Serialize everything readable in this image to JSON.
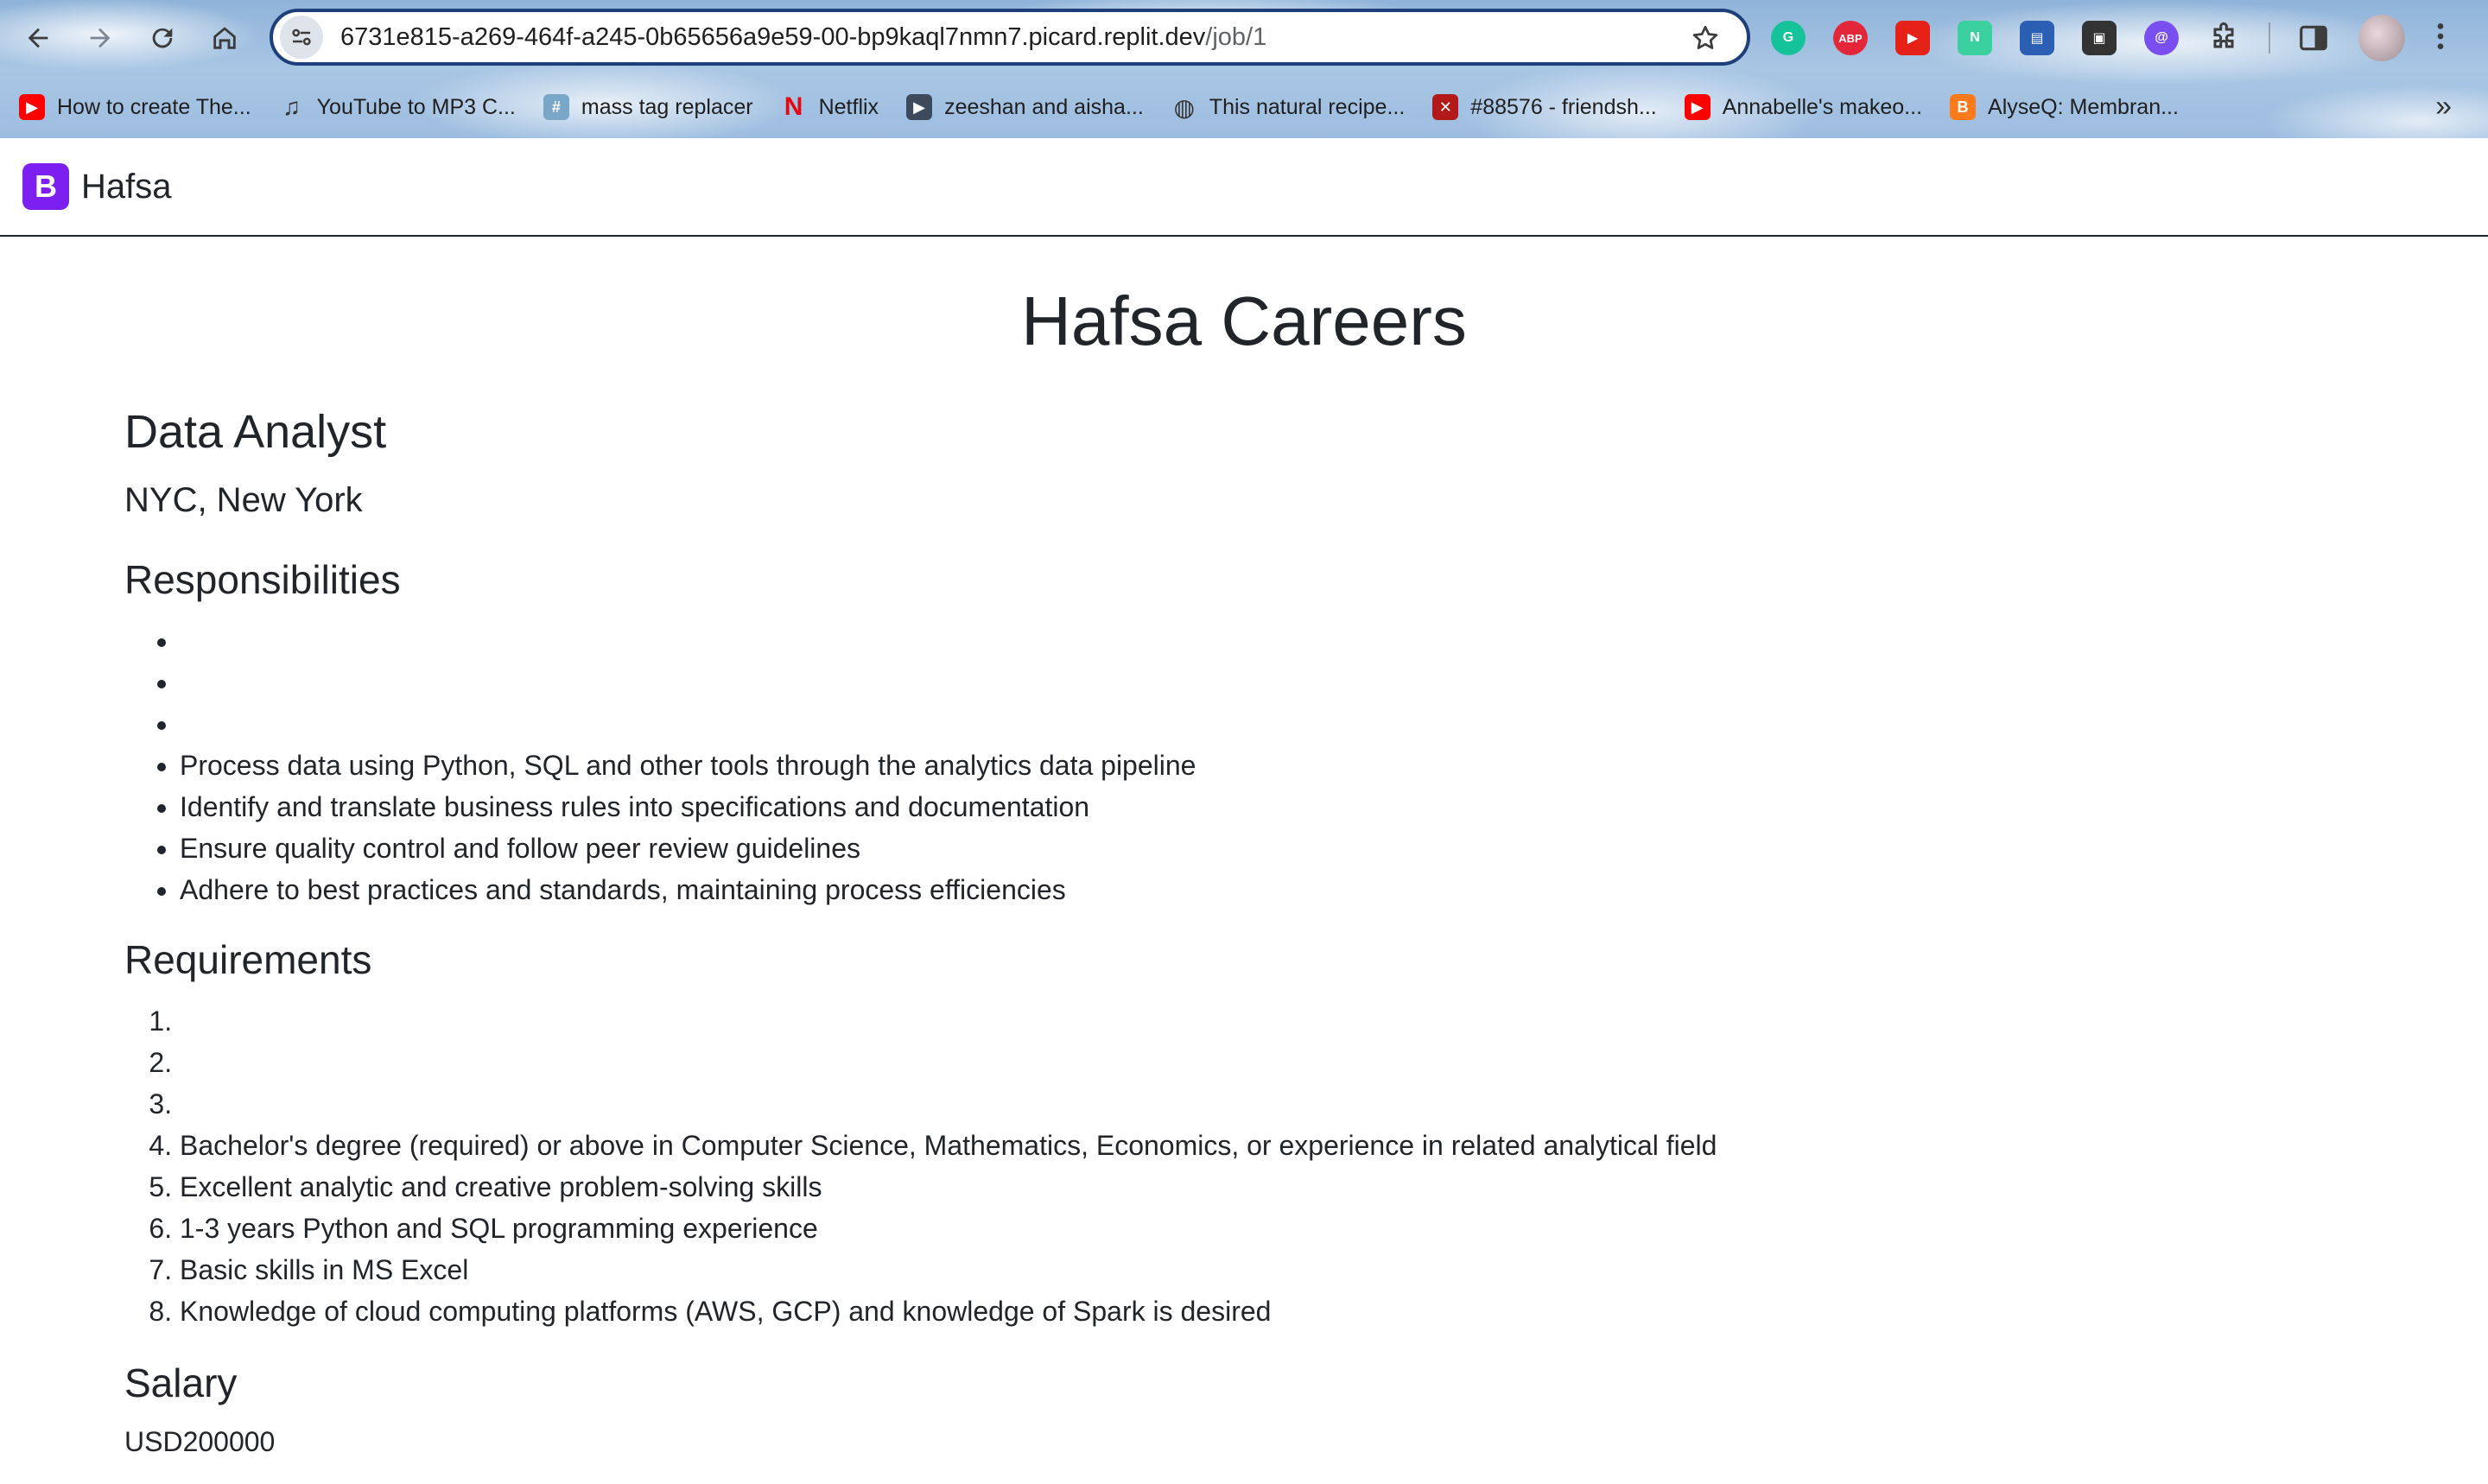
{
  "browser": {
    "url_host": "6731e815-a269-464f-a245-0b65656a9e59-00-bp9kaql7nmn7.picard.replit.dev",
    "url_path": "/job/1",
    "bookmarks": [
      {
        "icon": "youtube-icon",
        "color": "#ff0000",
        "label": "How to create The..."
      },
      {
        "icon": "music-note-icon",
        "color": "#333333",
        "label": "YouTube to MP3 C..."
      },
      {
        "icon": "hashtag-icon",
        "color": "#7aa7c7",
        "label": "mass tag replacer"
      },
      {
        "icon": "netflix-icon",
        "color": "#e50914",
        "label": "Netflix"
      },
      {
        "icon": "play-circle-icon",
        "color": "#3c4a5c",
        "label": "zeeshan and aisha..."
      },
      {
        "icon": "globe-icon",
        "color": "#333333",
        "label": "This natural recipe..."
      },
      {
        "icon": "ao3-icon",
        "color": "#b21a1a",
        "label": "#88576 - friendsh..."
      },
      {
        "icon": "youtube-icon",
        "color": "#ff0000",
        "label": "Annabelle's makeo..."
      },
      {
        "icon": "blogger-icon",
        "color": "#ff7a1a",
        "label": "AlyseQ: Membran..."
      }
    ],
    "extensions": [
      {
        "icon": "grammarly-icon",
        "color": "#15c39a",
        "text": "G"
      },
      {
        "icon": "adblock-icon",
        "color": "#e3263a",
        "text": "ABP"
      },
      {
        "icon": "youtube-ext-icon",
        "color": "#e62117",
        "text": "▶"
      },
      {
        "icon": "notion-n-icon",
        "color": "#3ad0a0",
        "text": "N"
      },
      {
        "icon": "reader-icon",
        "color": "#2b5fb3",
        "text": "▤"
      },
      {
        "icon": "picture-in-picture-icon",
        "color": "#333333",
        "text": "▣"
      },
      {
        "icon": "extension-purple-icon",
        "color": "#7a4ff0",
        "text": "@"
      }
    ]
  },
  "navbar": {
    "logo_letter": "B",
    "brand": "Hafsa"
  },
  "page": {
    "title": "Hafsa Careers",
    "job_title": "Data Analyst",
    "location": "NYC, New York",
    "responsibilities_heading": "Responsibilities",
    "responsibilities": [
      "",
      "",
      "",
      "Process data using Python, SQL and other tools through the analytics data pipeline",
      "Identify and translate business rules into specifications and documentation",
      "Ensure quality control and follow peer review guidelines",
      "Adhere to best practices and standards, maintaining process efficiencies"
    ],
    "requirements_heading": "Requirements",
    "requirements": [
      "",
      "",
      "",
      "Bachelor's degree (required) or above in Computer Science, Mathematics, Economics, or experience in related analytical field",
      "Excellent analytic and creative problem-solving skills",
      "1-3 years Python and SQL programming experience",
      "Basic skills in MS Excel",
      "Knowledge of cloud computing platforms (AWS, GCP) and knowledge of Spark is desired"
    ],
    "salary_heading": "Salary",
    "salary": "USD200000"
  }
}
